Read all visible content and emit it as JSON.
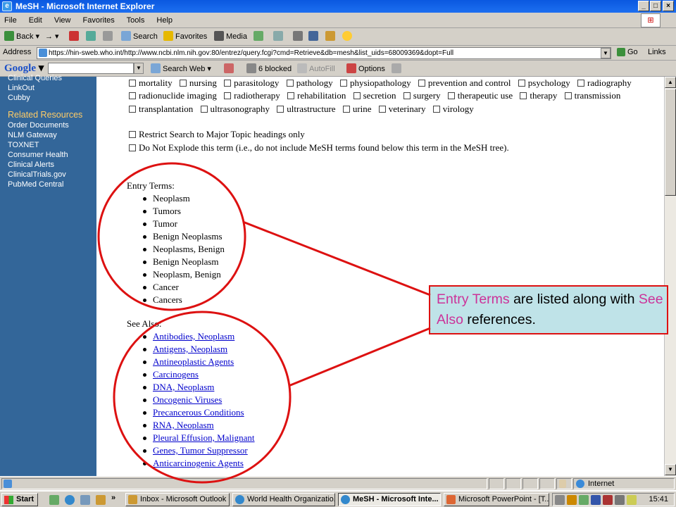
{
  "window": {
    "title": "MeSH - Microsoft Internet Explorer",
    "min": "_",
    "max": "□",
    "close": "×"
  },
  "menu": [
    "File",
    "Edit",
    "View",
    "Favorites",
    "Tools",
    "Help"
  ],
  "toolbar": {
    "back": "Back",
    "forward": "→",
    "search": "Search",
    "favorites": "Favorites",
    "media": "Media"
  },
  "address": {
    "label": "Address",
    "url": "https://hin-sweb.who.int/http://www.ncbi.nlm.nih.gov:80/entrez/query.fcgi?cmd=Retrieve&db=mesh&list_uids=68009369&dopt=Full",
    "go": "Go",
    "links": "Links"
  },
  "google_bar": {
    "logo": "Google",
    "search_web": "Search Web",
    "blocked": "6 blocked",
    "autofill": "AutoFill",
    "options": "Options"
  },
  "sidebar": {
    "top_items": [
      "Clinical Queries",
      "LinkOut",
      "Cubby"
    ],
    "related_header": "Related Resources",
    "related_items": [
      "Order Documents",
      "NLM Gateway",
      "TOXNET",
      "Consumer Health",
      "Clinical Alerts",
      "ClinicalTrials.gov",
      "PubMed Central"
    ]
  },
  "subheadings": [
    [
      "mortality",
      "nursing",
      "parasitology",
      "pathology",
      "physiopathology",
      "prevention and control",
      "psychology",
      "radiography"
    ],
    [
      "radionuclide imaging",
      "radiotherapy",
      "rehabilitation",
      "secretion",
      "surgery",
      "therapeutic use",
      "therapy",
      "transmission"
    ],
    [
      "transplantation",
      "ultrasonography",
      "ultrastructure",
      "urine",
      "veterinary",
      "virology"
    ]
  ],
  "options": {
    "restrict": "Restrict Search to Major Topic headings only",
    "no_explode": "Do Not Explode this term (i.e., do not include MeSH terms found below this term in the MeSH tree)."
  },
  "entry_terms": {
    "label": "Entry Terms:",
    "items": [
      "Neoplasm",
      "Tumors",
      "Tumor",
      "Benign Neoplasms",
      "Neoplasms, Benign",
      "Benign Neoplasm",
      "Neoplasm, Benign",
      "Cancer",
      "Cancers"
    ]
  },
  "see_also": {
    "label": "See Also:",
    "items": [
      "Antibodies, Neoplasm",
      "Antigens, Neoplasm",
      "Antineoplastic Agents",
      "Carcinogens",
      "DNA, Neoplasm",
      "Oncogenic Viruses",
      "Precancerous Conditions",
      "RNA, Neoplasm",
      "Pleural Effusion, Malignant",
      "Genes, Tumor Suppressor",
      "Anticarcinogenic Agents"
    ]
  },
  "callout": {
    "part1": "Entry Terms",
    "part2": " are listed along with ",
    "part3": "See Also",
    "part4": " references."
  },
  "status": {
    "zone": "Internet"
  },
  "taskbar": {
    "start": "Start",
    "more": "»",
    "tasks": [
      "Inbox - Microsoft Outlook",
      "World Health Organizatio...",
      "MeSH - Microsoft Inte...",
      "Microsoft PowerPoint - [T..."
    ],
    "clock": "15:41"
  },
  "colors": {
    "sidebar": "#336699",
    "related_header": "#ffcc66",
    "link": "#0000cc",
    "annotation": "#dd1111",
    "callout_bg": "#bfe3e8",
    "callout_highlight": "#cc3399"
  }
}
